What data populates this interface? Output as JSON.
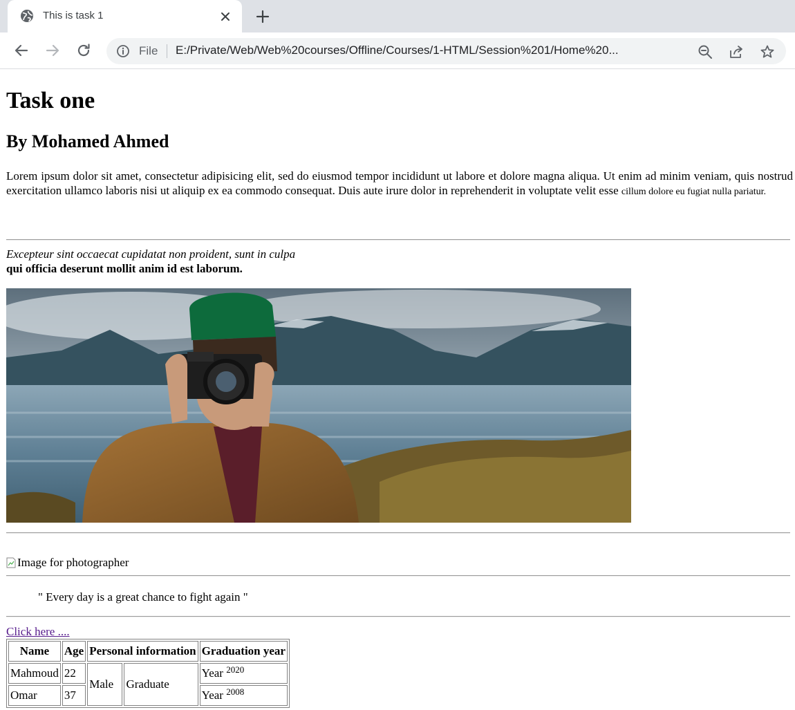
{
  "browser": {
    "tab_title": "This is task 1",
    "omnibox": {
      "scheme_label": "File",
      "url": "E:/Private/Web/Web%20courses/Offline/Courses/1-HTML/Session%201/Home%20..."
    },
    "icons": [
      "globe-icon",
      "close-icon",
      "plus-icon",
      "back-arrow-icon",
      "forward-arrow-icon",
      "reload-icon",
      "info-icon",
      "zoom-out-icon",
      "share-icon",
      "star-icon"
    ]
  },
  "page": {
    "title": "Task one",
    "subtitle": "By Mohamed Ahmed",
    "lorem_main": "Lorem ipsum dolor sit amet, consectetur adipisicing elit, sed do eiusmod tempor incididunt ut labore et dolore magna aliqua. Ut enim ad minim veniam, quis nostrud exercitation ullamco laboris nisi ut aliquip ex ea commodo consequat. Duis aute irure dolor in reprehenderit in voluptate velit esse ",
    "lorem_small": "cillum dolore eu fugiat nulla pariatur.",
    "italic_line": "Excepteur sint occaecat cupidatat non proident, sunt in culpa",
    "bold_line": "qui officia deserunt mollit anim id est laborum.",
    "broken_image_alt": "Image for photographer",
    "quote": "\" Every day is a great chance to fight again \"",
    "link_text": "Click here ....",
    "table": {
      "headers": [
        "Name",
        "Age",
        "Personal information",
        "Graduation year"
      ],
      "rows": [
        {
          "name": "Mahmoud",
          "age": "22",
          "year_label": "Year",
          "year_value": "2020"
        },
        {
          "name": "Omar",
          "age": "37",
          "year_label": "Year",
          "year_value": "2008"
        }
      ],
      "gender": "Male",
      "status": "Graduate"
    }
  }
}
